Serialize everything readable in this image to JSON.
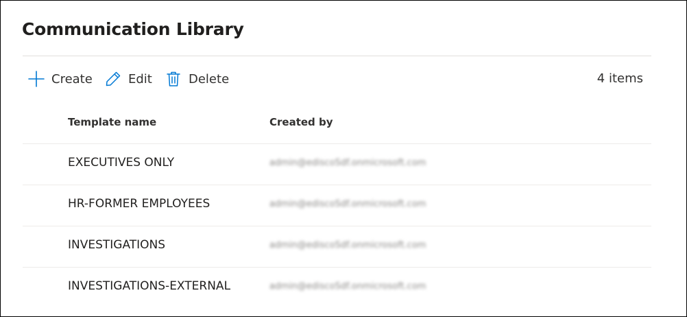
{
  "page": {
    "title": "Communication Library"
  },
  "toolbar": {
    "create_label": "Create",
    "edit_label": "Edit",
    "delete_label": "Delete",
    "item_count": "4 items"
  },
  "table": {
    "headers": {
      "name": "Template name",
      "created_by": "Created by"
    },
    "rows": [
      {
        "name": "EXECUTIVES ONLY",
        "created_by": "admin@ediscoSdf.onmicrosoft.com"
      },
      {
        "name": "HR-FORMER EMPLOYEES",
        "created_by": "admin@ediscoSdf.onmicrosoft.com"
      },
      {
        "name": "INVESTIGATIONS",
        "created_by": "admin@ediscoSdf.onmicrosoft.com"
      },
      {
        "name": "INVESTIGATIONS-EXTERNAL",
        "created_by": "admin@ediscoSdf.onmicrosoft.com"
      }
    ]
  },
  "colors": {
    "accent": "#0078d4",
    "text": "#323130",
    "divider": "#edebe9"
  },
  "icons": {
    "create": "plus-icon",
    "edit": "pencil-icon",
    "delete": "trash-icon"
  }
}
